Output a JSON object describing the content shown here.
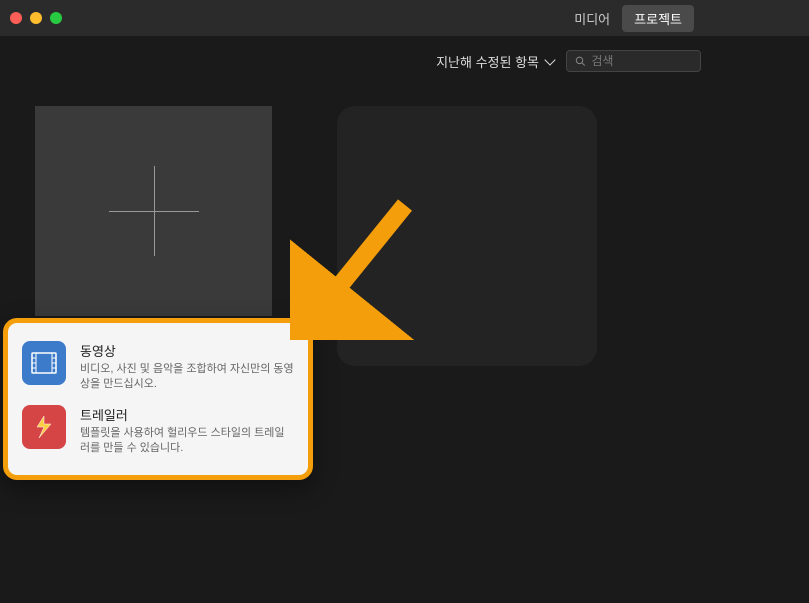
{
  "nav": {
    "media_label": "미디어",
    "projects_label": "프로젝트"
  },
  "toolbar": {
    "filter_label": "지난해 수정된 항목",
    "search_placeholder": "검색"
  },
  "popover": {
    "movie": {
      "title": "동영상",
      "desc": "비디오, 사진 및 음악을 조합하여 자신만의 동영상을 만드십시오."
    },
    "trailer": {
      "title": "트레일러",
      "desc": "템플릿을 사용하여 헐리우드 스타일의 트레일러를 만들 수 있습니다."
    }
  },
  "colors": {
    "highlight": "#f59e0b"
  }
}
